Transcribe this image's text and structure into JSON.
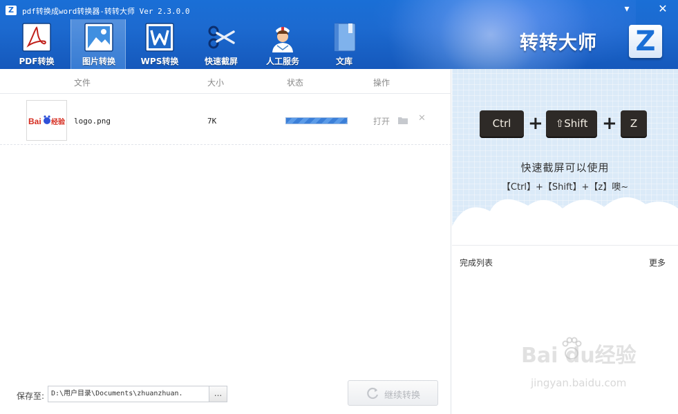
{
  "window": {
    "app_icon_letter": "Z",
    "title": "pdf转换成word转换器-转转大师 Ver 2.3.0.0",
    "minimize_glyph": "▾",
    "close_glyph": "✕"
  },
  "tabs": [
    {
      "label": "PDF转换",
      "icon": "pdf-icon",
      "active": false
    },
    {
      "label": "图片转换",
      "icon": "image-icon",
      "active": true
    },
    {
      "label": "WPS转换",
      "icon": "wps-icon",
      "active": false
    },
    {
      "label": "快速截屏",
      "icon": "scissors-icon",
      "active": false
    },
    {
      "label": "人工服务",
      "icon": "nurse-icon",
      "active": false
    },
    {
      "label": "文库",
      "icon": "book-icon",
      "active": false
    }
  ],
  "brand": {
    "name": "转转大师",
    "logo_letter": "Z"
  },
  "file_table": {
    "headers": {
      "file": "文件",
      "size": "大小",
      "status": "状态",
      "action": "操作"
    },
    "rows": [
      {
        "thumb_text": "Bai",
        "thumb_text2": "经验",
        "name": "logo.png",
        "size": "7K",
        "progress": 1.0,
        "open_label": "打开"
      }
    ]
  },
  "save": {
    "label": "保存至:",
    "path": "D:\\用户目录\\Documents\\zhuanzhuan.",
    "browse_label": "..."
  },
  "continue_button": {
    "label": "继续转换"
  },
  "promo": {
    "keys": [
      "Ctrl",
      "⇧Shift",
      "Z"
    ],
    "plus": "+",
    "line1": "快速截屏可以使用",
    "line2": "【Ctrl】+【Shift】+【z】噢~"
  },
  "done_list": {
    "title": "完成列表",
    "more_label": "更多"
  },
  "watermark": {
    "text": "Bai  du经验",
    "sub": "jingyan.baidu.com"
  },
  "colors": {
    "header_blue": "#1a6fd6",
    "progress_blue": "#3b7fd8",
    "panel_blue": "#dbeaf8"
  }
}
